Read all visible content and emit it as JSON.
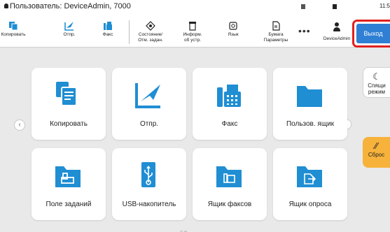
{
  "topbar": {
    "user_line": "Пользователь: DeviceAdmin, 7000",
    "clock": "11:5",
    "buttons": {
      "copy": "Копировать",
      "send": "Отпр.",
      "fax": "Факс",
      "status_1": "Состояние/",
      "status_2": "Отм. задан.",
      "info_1": "Информ.",
      "info_2": "об устр.",
      "language": "Язык",
      "paper_1": "Бумага",
      "paper_2": "Параметры",
      "more": "•••",
      "user": "DeviceAdmin",
      "logout": "Выход"
    }
  },
  "tiles": [
    {
      "label": "Копировать",
      "icon": "copy-icon"
    },
    {
      "label": "Отпр.",
      "icon": "send-icon"
    },
    {
      "label": "Факс",
      "icon": "fax-icon"
    },
    {
      "label": "Пользов. ящик",
      "icon": "folder-icon"
    },
    {
      "label": "Поле заданий",
      "icon": "job-box-icon"
    },
    {
      "label": "USB-накопитель",
      "icon": "usb-icon"
    },
    {
      "label": "Ящик факсов",
      "icon": "fax-box-icon"
    },
    {
      "label": "Ящик опроса",
      "icon": "polling-box-icon"
    }
  ],
  "side": {
    "sleep_1": "Спящи",
    "sleep_2": "режим",
    "reset": "Сброс"
  },
  "nav": {
    "left": "‹",
    "right": "›"
  },
  "colors": {
    "accent": "#1f8ed3",
    "logout_bg": "#2f7fd4",
    "logout_outline": "#e0211e",
    "reset_bg": "#f6b23b"
  }
}
